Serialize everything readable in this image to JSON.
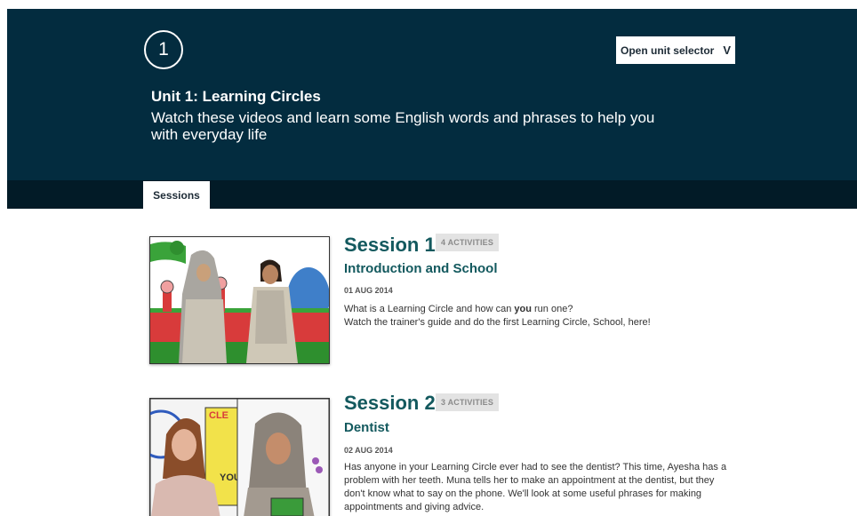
{
  "header": {
    "unit_number": "1",
    "unit_title": "Unit 1: Learning Circles",
    "unit_description": "Watch these videos and learn some English words and phrases to help you with everyday life",
    "selector_label": "Open unit selector",
    "selector_chevron": "V"
  },
  "tabs": {
    "sessions_label": "Sessions"
  },
  "sessions": [
    {
      "title": "Session 1",
      "activities": "4 ACTIVITIES",
      "subtitle": "Introduction and School",
      "date": "01 AUG 2014",
      "desc_part1": "What is a Learning Circle and how can ",
      "desc_bold": "you",
      "desc_part2": " run one?",
      "desc_line2": "Watch the trainer's guide and do the first Learning Circle, School, here!"
    },
    {
      "title": "Session 2",
      "activities": "3 ACTIVITIES",
      "subtitle": "Dentist",
      "date": "02 AUG 2014",
      "description": "Has anyone in your Learning Circle ever had to see the dentist? This time, Ayesha has a problem with her teeth. Muna tells her to make an appointment at the dentist, but they don't know what to say on the phone. We'll look at some useful phrases for making appointments and giving advice.",
      "thumb_sign_text_1": "CLE",
      "thumb_sign_text_2": "YOU"
    }
  ],
  "colors": {
    "header_bg": "#032c3f",
    "tabbar_bg": "#021b27",
    "session_accent": "#13595e"
  }
}
